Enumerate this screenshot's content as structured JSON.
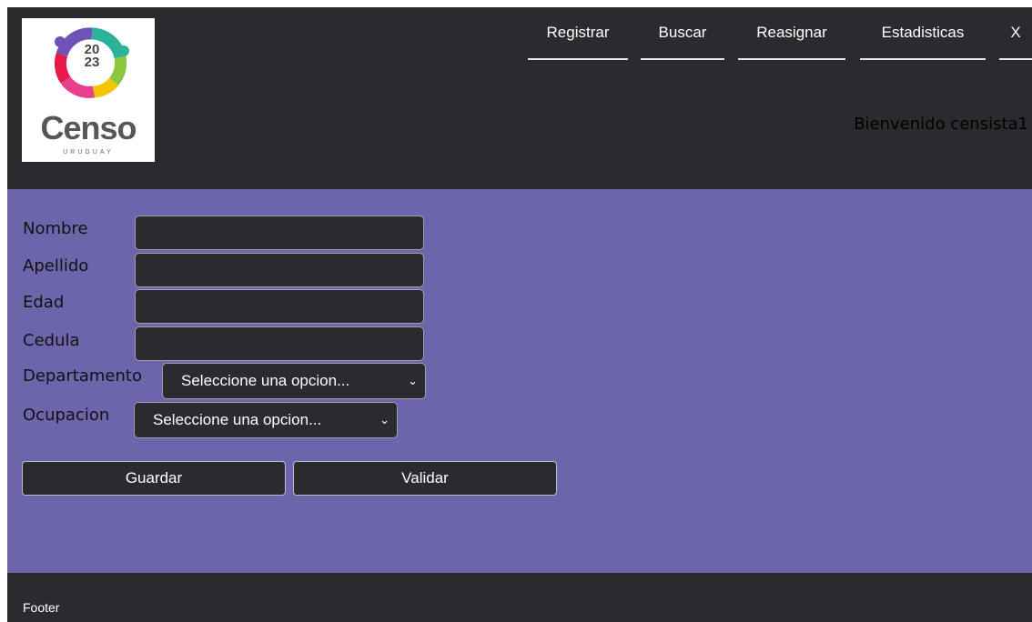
{
  "logo": {
    "year_top": "20",
    "year_bottom": "23",
    "word": "Censo",
    "country": "URUGUAY"
  },
  "nav": {
    "items": [
      {
        "label": "Registrar"
      },
      {
        "label": "Buscar"
      },
      {
        "label": "Reasignar"
      },
      {
        "label": "Estadisticas"
      },
      {
        "label": "X"
      }
    ]
  },
  "header": {
    "welcome": "Bienvenido censista1"
  },
  "form": {
    "nombre_label": "Nombre",
    "apellido_label": "Apellido",
    "edad_label": "Edad",
    "cedula_label": "Cedula",
    "departamento_label": "Departamento",
    "departamento_value": "Seleccione una opcion...",
    "ocupacion_label": "Ocupacion",
    "ocupacion_value": "Seleccione una opcion...",
    "guardar_label": "Guardar",
    "validar_label": "Validar"
  },
  "footer": {
    "text": "Footer"
  },
  "colors": {
    "dark": "#2c2a2f",
    "main_bg": "#6c65ab"
  },
  "icons": {
    "select_arrow": "chevron-down-icon"
  }
}
